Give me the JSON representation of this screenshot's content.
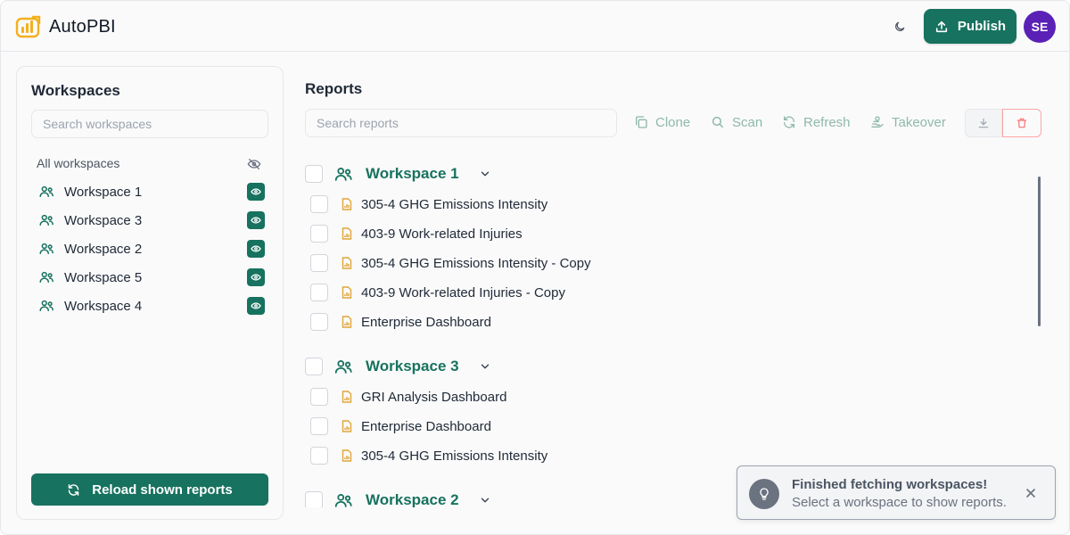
{
  "app": {
    "title": "AutoPBI",
    "brand_color": "#17725f",
    "accent_purple": "#5b21b6"
  },
  "header": {
    "theme_icon": "moon-icon",
    "publish_label": "Publish",
    "avatar_initials": "SE"
  },
  "sidebar": {
    "title": "Workspaces",
    "search_placeholder": "Search workspaces",
    "all_label": "All workspaces",
    "items": [
      {
        "label": "Workspace 1"
      },
      {
        "label": "Workspace 3"
      },
      {
        "label": "Workspace 2"
      },
      {
        "label": "Workspace 5"
      },
      {
        "label": "Workspace 4"
      }
    ],
    "reload_label": "Reload shown reports"
  },
  "reports": {
    "title": "Reports",
    "search_placeholder": "Search reports",
    "toolbar": {
      "clone": "Clone",
      "scan": "Scan",
      "refresh": "Refresh",
      "takeover": "Takeover"
    },
    "groups": [
      {
        "name": "Workspace 1",
        "reports": [
          "305-4 GHG Emissions Intensity",
          "403-9 Work-related Injuries",
          "305-4 GHG Emissions Intensity - Copy",
          "403-9 Work-related Injuries - Copy",
          "Enterprise Dashboard"
        ]
      },
      {
        "name": "Workspace 3",
        "reports": [
          "GRI Analysis Dashboard",
          "Enterprise Dashboard",
          "305-4 GHG Emissions Intensity"
        ]
      },
      {
        "name": "Workspace 2",
        "reports": []
      }
    ]
  },
  "toast": {
    "title": "Finished fetching workspaces!",
    "message": "Select a workspace to show reports."
  }
}
